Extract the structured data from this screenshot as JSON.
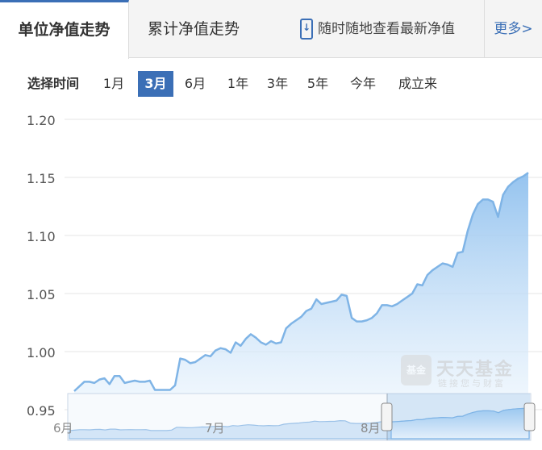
{
  "tabs": [
    {
      "label": "单位净值走势",
      "active": true
    },
    {
      "label": "累计净值走势",
      "active": false
    }
  ],
  "promo": {
    "icon": "phone-download-icon",
    "text": "随时随地查看最新净值"
  },
  "more": {
    "label": "更多>"
  },
  "range": {
    "label": "选择时间",
    "options": [
      "1月",
      "3月",
      "6月",
      "1年",
      "3年",
      "5年",
      "今年",
      "成立来"
    ],
    "selected": "3月"
  },
  "watermark": {
    "logo": "基金",
    "name": "天天基金",
    "tagline": "链接您与财富"
  },
  "colors": {
    "accent": "#3b6fb6",
    "line": "#7fb4e6",
    "area_top": "#8fc0ee",
    "area_bottom": "#eaf4fd",
    "grid": "#e6e6e6"
  },
  "chart_data": {
    "type": "area",
    "title": "",
    "xlabel": "",
    "ylabel": "",
    "ylim": [
      0.95,
      1.2
    ],
    "yticks": [
      "1.20",
      "1.15",
      "1.10",
      "1.05",
      "1.00",
      "0.95"
    ],
    "xticks": [
      "6月",
      "7月",
      "8月"
    ],
    "grid": true,
    "series": [
      {
        "values": [
          0.966,
          0.97,
          0.974,
          0.974,
          0.973,
          0.976,
          0.977,
          0.972,
          0.979,
          0.979,
          0.973,
          0.974,
          0.975,
          0.974,
          0.974,
          0.975,
          0.967,
          0.967,
          0.967,
          0.967,
          0.971,
          0.994,
          0.993,
          0.99,
          0.991,
          0.994,
          0.997,
          0.996,
          1.001,
          1.003,
          1.002,
          0.999,
          1.008,
          1.005,
          1.011,
          1.015,
          1.012,
          1.008,
          1.006,
          1.009,
          1.007,
          1.008,
          1.02,
          1.024,
          1.027,
          1.03,
          1.035,
          1.037,
          1.045,
          1.041,
          1.042,
          1.043,
          1.044,
          1.049,
          1.048,
          1.029,
          1.026,
          1.026,
          1.027,
          1.029,
          1.033,
          1.04,
          1.04,
          1.039,
          1.041,
          1.044,
          1.047,
          1.05,
          1.058,
          1.057,
          1.066,
          1.07,
          1.073,
          1.076,
          1.075,
          1.073,
          1.085,
          1.086,
          1.104,
          1.118,
          1.127,
          1.131,
          1.131,
          1.129,
          1.116,
          1.135,
          1.142,
          1.146,
          1.149,
          1.151,
          1.154
        ]
      }
    ]
  }
}
